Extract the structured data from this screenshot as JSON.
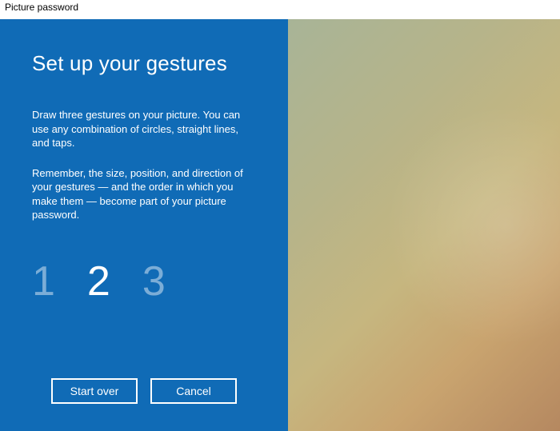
{
  "window": {
    "title": "Picture password"
  },
  "panel": {
    "heading": "Set up your gestures",
    "paragraph1": "Draw three gestures on your picture. You can use any combination of circles, straight lines, and taps.",
    "paragraph2": "Remember, the size, position, and direction of your gestures — and the order in which you make them — become part of your picture password."
  },
  "steps": {
    "items": [
      "1",
      "2",
      "3"
    ],
    "active_index": 1
  },
  "buttons": {
    "start_over": "Start over",
    "cancel": "Cancel"
  }
}
